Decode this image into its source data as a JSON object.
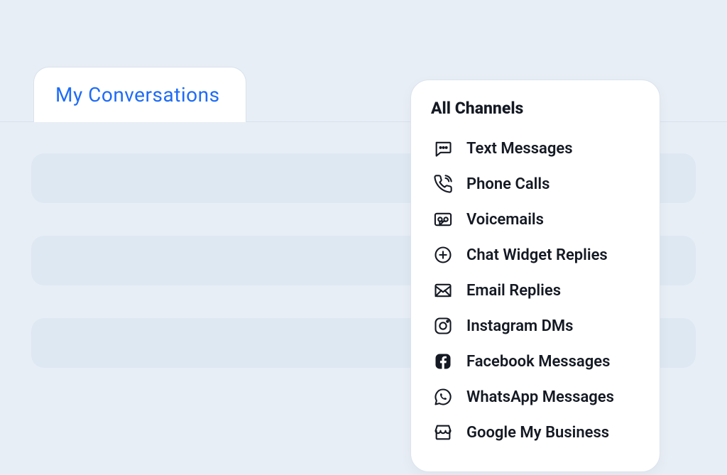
{
  "tab": {
    "label": "My Conversations"
  },
  "panel": {
    "title": "All Channels",
    "channels": [
      {
        "label": "Text Messages"
      },
      {
        "label": "Phone Calls"
      },
      {
        "label": "Voicemails"
      },
      {
        "label": "Chat Widget Replies"
      },
      {
        "label": "Email Replies"
      },
      {
        "label": "Instagram DMs"
      },
      {
        "label": "Facebook Messages"
      },
      {
        "label": "WhatsApp Messages"
      },
      {
        "label": "Google My Business"
      }
    ]
  }
}
